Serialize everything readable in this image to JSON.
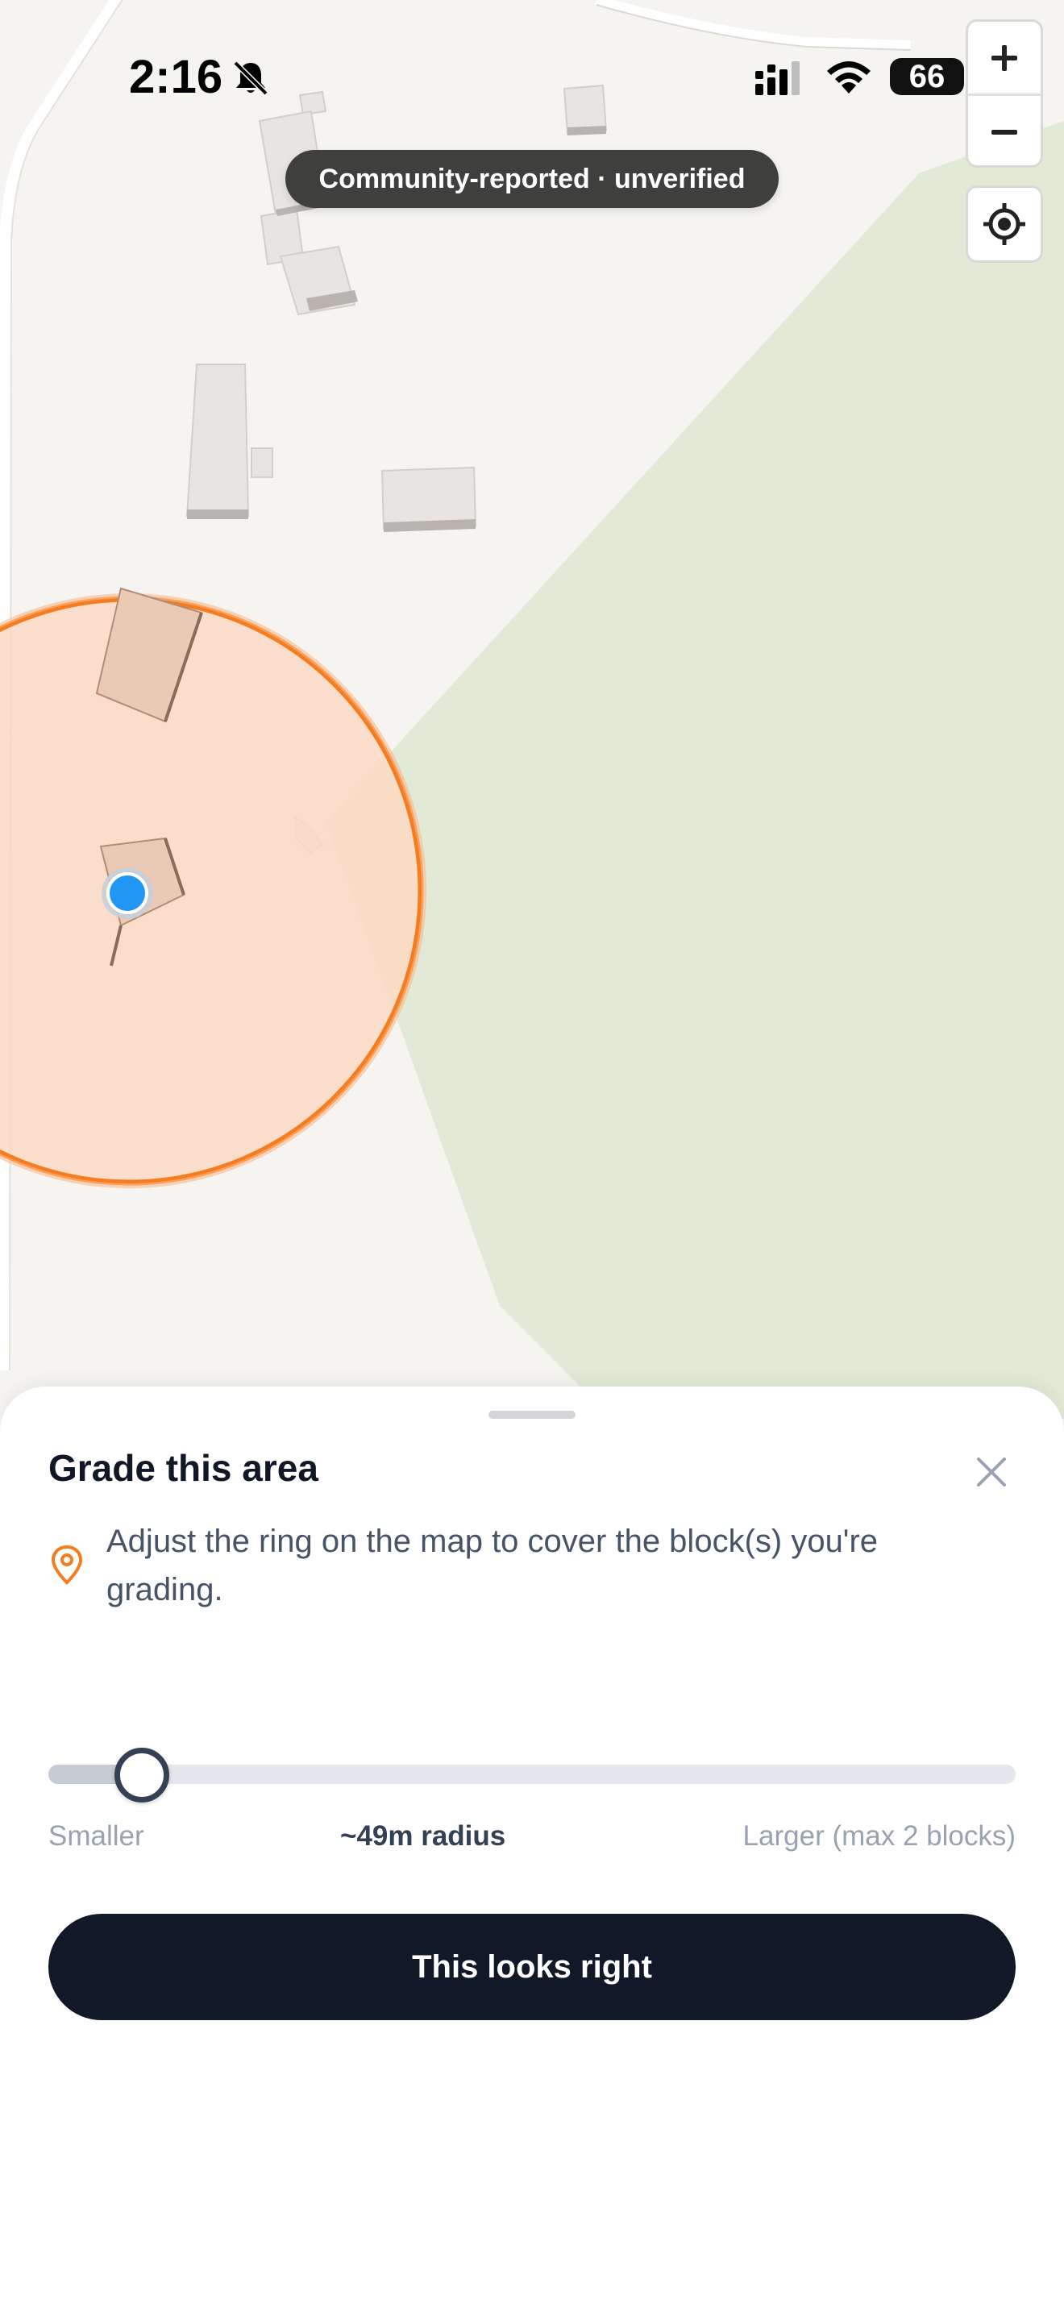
{
  "status_bar": {
    "time": "2:16",
    "battery": "66",
    "icons": [
      "bell-slash-icon",
      "cellular-signal-icon",
      "wifi-icon",
      "battery-icon"
    ]
  },
  "map": {
    "banner": "Community-reported · unverified",
    "controls": {
      "zoom_in_icon": "plus-icon",
      "zoom_out_icon": "minus-icon",
      "locate_icon": "crosshair-icon"
    },
    "colors": {
      "ring": "#f57c1f",
      "ring_fill": "#fbd9c4",
      "user_dot": "#2196f3",
      "park": "#e2ead7",
      "land": "#f6f4f1"
    }
  },
  "sheet": {
    "title": "Grade this area",
    "close_icon": "close-icon",
    "hint_icon": "map-pin-icon",
    "hint": "Adjust the ring on the map to cover the block(s) you're grading.",
    "slider": {
      "min_label": "Smaller",
      "value_label": "~49m radius",
      "max_label": "Larger (max 2 blocks)",
      "position": 0.068
    },
    "confirm_button": "This looks right"
  }
}
